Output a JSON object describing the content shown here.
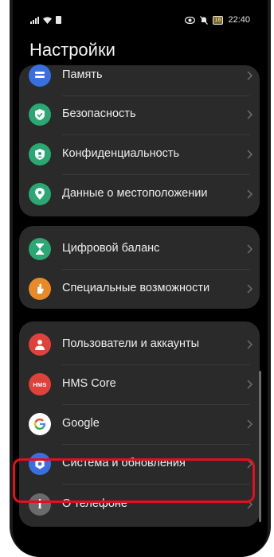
{
  "status_bar": {
    "time": "22:40",
    "battery": "16"
  },
  "title": "Настройки",
  "groups": [
    {
      "items": [
        {
          "label": "Память",
          "icon": "storage-icon",
          "color": "#3a6fe0"
        },
        {
          "label": "Безопасность",
          "icon": "shield-check-icon",
          "color": "#2aa772"
        },
        {
          "label": "Конфиденциальность",
          "icon": "privacy-shield-icon",
          "color": "#2aa772"
        },
        {
          "label": "Данные о местоположении",
          "icon": "location-pin-icon",
          "color": "#2aa772"
        }
      ]
    },
    {
      "items": [
        {
          "label": "Цифровой баланс",
          "icon": "hourglass-icon",
          "color": "#2aa772"
        },
        {
          "label": "Специальные возможности",
          "icon": "accessibility-hand-icon",
          "color": "#e98a2a"
        }
      ]
    },
    {
      "items": [
        {
          "label": "Пользователи и аккаунты",
          "icon": "user-icon",
          "color": "#e0413a"
        },
        {
          "label": "HMS Core",
          "icon": "hms-core-icon",
          "icon_text": "HMS",
          "color": "#e0413a"
        },
        {
          "label": "Google",
          "icon": "google-icon",
          "icon_text": "G",
          "color": "#ffffff"
        },
        {
          "label": "Система и обновления",
          "icon": "system-gear-icon",
          "color": "#3a6fe0"
        },
        {
          "label": "О телефоне",
          "icon": "info-icon",
          "icon_text": "i",
          "color": "#8c8c8c"
        }
      ]
    }
  ]
}
